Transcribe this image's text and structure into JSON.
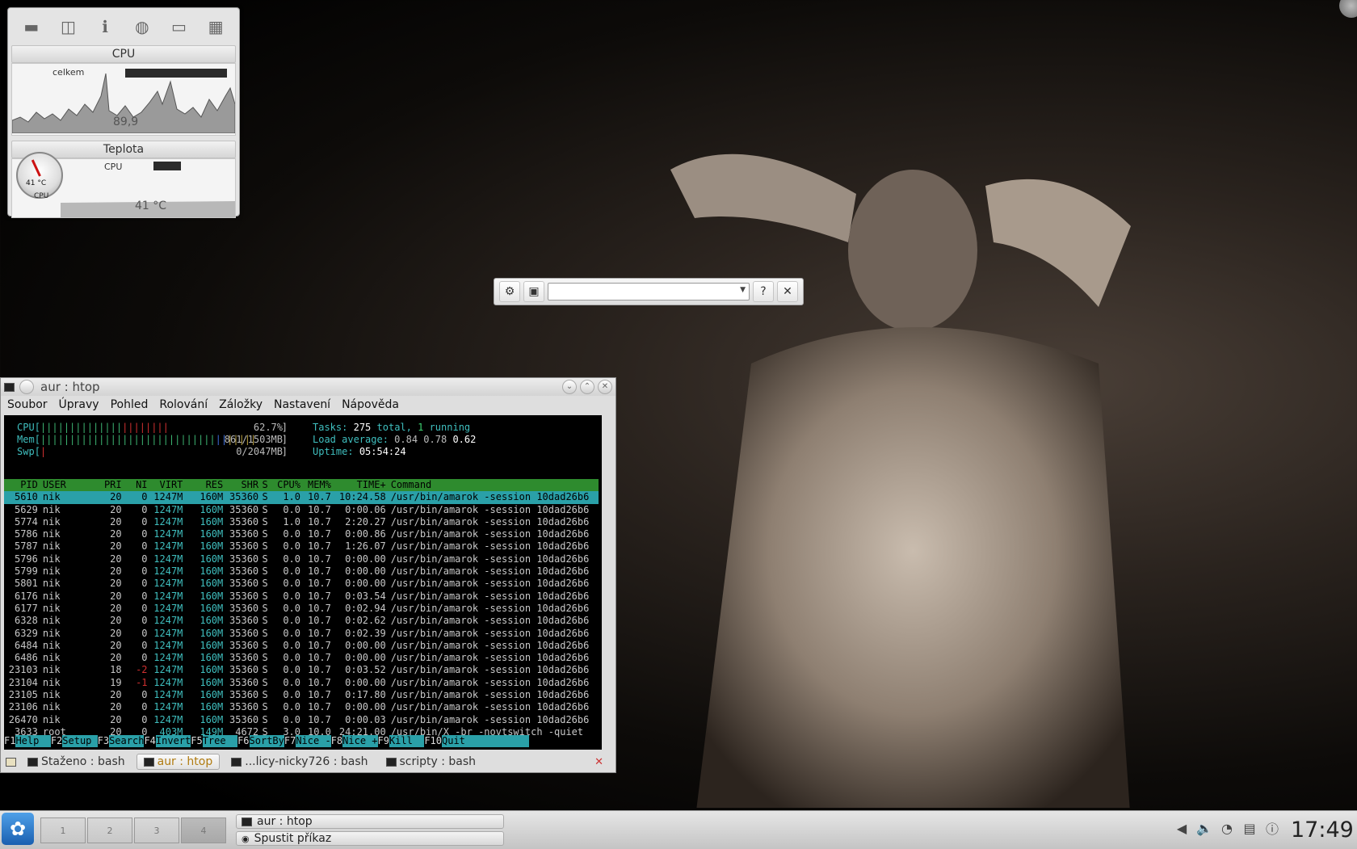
{
  "sysmon": {
    "icons": [
      "hdd-icon",
      "disk-icon",
      "info-icon",
      "network-icon",
      "battery-icon",
      "chip-icon"
    ],
    "cpu": {
      "title": "CPU",
      "label": "celkem",
      "value": "89,9"
    },
    "temp": {
      "title": "Teplota",
      "label": "CPU",
      "value": "41 °C",
      "gauge_value": "41 °C",
      "gauge_caption": "CPU"
    }
  },
  "krunner": {
    "input_value": ""
  },
  "konsole": {
    "title": "aur : htop",
    "menu": [
      "Soubor",
      "Úpravy",
      "Pohled",
      "Rolování",
      "Záložky",
      "Nastavení",
      "Nápověda"
    ],
    "htop": {
      "cpu": {
        "label": "CPU",
        "value": "62.7%"
      },
      "mem": {
        "label": "Mem",
        "value": "861/1503MB"
      },
      "swp": {
        "label": "Swp",
        "value": "0/2047MB"
      },
      "tasks_label": "Tasks:",
      "tasks_total": "275",
      "tasks_total_suffix": "total,",
      "tasks_running": "1",
      "tasks_running_suffix": "running",
      "load_label": "Load average:",
      "load1": "0.84",
      "load5": "0.78",
      "load15": "0.62",
      "uptime_label": "Uptime:",
      "uptime": "05:54:24",
      "header": [
        "PID",
        "USER",
        "PRI",
        "NI",
        "VIRT",
        "RES",
        "SHR",
        "S",
        "CPU%",
        "MEM%",
        "TIME+",
        "Command"
      ],
      "rows": [
        [
          "5610",
          "nik",
          "20",
          "0",
          "1247M",
          "160M",
          "35360",
          "S",
          "1.0",
          "10.7",
          "10:24.58",
          "/usr/bin/amarok -session 10dad26b6"
        ],
        [
          "5629",
          "nik",
          "20",
          "0",
          "1247M",
          "160M",
          "35360",
          "S",
          "0.0",
          "10.7",
          "0:00.06",
          "/usr/bin/amarok -session 10dad26b6"
        ],
        [
          "5774",
          "nik",
          "20",
          "0",
          "1247M",
          "160M",
          "35360",
          "S",
          "1.0",
          "10.7",
          "2:20.27",
          "/usr/bin/amarok -session 10dad26b6"
        ],
        [
          "5786",
          "nik",
          "20",
          "0",
          "1247M",
          "160M",
          "35360",
          "S",
          "0.0",
          "10.7",
          "0:00.86",
          "/usr/bin/amarok -session 10dad26b6"
        ],
        [
          "5787",
          "nik",
          "20",
          "0",
          "1247M",
          "160M",
          "35360",
          "S",
          "0.0",
          "10.7",
          "1:26.07",
          "/usr/bin/amarok -session 10dad26b6"
        ],
        [
          "5796",
          "nik",
          "20",
          "0",
          "1247M",
          "160M",
          "35360",
          "S",
          "0.0",
          "10.7",
          "0:00.00",
          "/usr/bin/amarok -session 10dad26b6"
        ],
        [
          "5799",
          "nik",
          "20",
          "0",
          "1247M",
          "160M",
          "35360",
          "S",
          "0.0",
          "10.7",
          "0:00.00",
          "/usr/bin/amarok -session 10dad26b6"
        ],
        [
          "5801",
          "nik",
          "20",
          "0",
          "1247M",
          "160M",
          "35360",
          "S",
          "0.0",
          "10.7",
          "0:00.00",
          "/usr/bin/amarok -session 10dad26b6"
        ],
        [
          "6176",
          "nik",
          "20",
          "0",
          "1247M",
          "160M",
          "35360",
          "S",
          "0.0",
          "10.7",
          "0:03.54",
          "/usr/bin/amarok -session 10dad26b6"
        ],
        [
          "6177",
          "nik",
          "20",
          "0",
          "1247M",
          "160M",
          "35360",
          "S",
          "0.0",
          "10.7",
          "0:02.94",
          "/usr/bin/amarok -session 10dad26b6"
        ],
        [
          "6328",
          "nik",
          "20",
          "0",
          "1247M",
          "160M",
          "35360",
          "S",
          "0.0",
          "10.7",
          "0:02.62",
          "/usr/bin/amarok -session 10dad26b6"
        ],
        [
          "6329",
          "nik",
          "20",
          "0",
          "1247M",
          "160M",
          "35360",
          "S",
          "0.0",
          "10.7",
          "0:02.39",
          "/usr/bin/amarok -session 10dad26b6"
        ],
        [
          "6484",
          "nik",
          "20",
          "0",
          "1247M",
          "160M",
          "35360",
          "S",
          "0.0",
          "10.7",
          "0:00.00",
          "/usr/bin/amarok -session 10dad26b6"
        ],
        [
          "6486",
          "nik",
          "20",
          "0",
          "1247M",
          "160M",
          "35360",
          "S",
          "0.0",
          "10.7",
          "0:00.00",
          "/usr/bin/amarok -session 10dad26b6"
        ],
        [
          "23103",
          "nik",
          "18",
          "-2",
          "1247M",
          "160M",
          "35360",
          "S",
          "0.0",
          "10.7",
          "0:03.52",
          "/usr/bin/amarok -session 10dad26b6"
        ],
        [
          "23104",
          "nik",
          "19",
          "-1",
          "1247M",
          "160M",
          "35360",
          "S",
          "0.0",
          "10.7",
          "0:00.00",
          "/usr/bin/amarok -session 10dad26b6"
        ],
        [
          "23105",
          "nik",
          "20",
          "0",
          "1247M",
          "160M",
          "35360",
          "S",
          "0.0",
          "10.7",
          "0:17.80",
          "/usr/bin/amarok -session 10dad26b6"
        ],
        [
          "23106",
          "nik",
          "20",
          "0",
          "1247M",
          "160M",
          "35360",
          "S",
          "0.0",
          "10.7",
          "0:00.00",
          "/usr/bin/amarok -session 10dad26b6"
        ],
        [
          "26470",
          "nik",
          "20",
          "0",
          "1247M",
          "160M",
          "35360",
          "S",
          "0.0",
          "10.7",
          "0:00.03",
          "/usr/bin/amarok -session 10dad26b6"
        ],
        [
          "3633",
          "root",
          "20",
          "0",
          "403M",
          "149M",
          "4672",
          "S",
          "3.0",
          "10.0",
          "24:21.00",
          "/usr/bin/X -br -novtswitch -quiet"
        ]
      ],
      "fkeys": [
        [
          "F1",
          "Help  "
        ],
        [
          "F2",
          "Setup "
        ],
        [
          "F3",
          "Search"
        ],
        [
          "F4",
          "Invert"
        ],
        [
          "F5",
          "Tree  "
        ],
        [
          "F6",
          "SortBy"
        ],
        [
          "F7",
          "Nice -"
        ],
        [
          "F8",
          "Nice +"
        ],
        [
          "F9",
          "Kill  "
        ],
        [
          "F10",
          "Quit           "
        ]
      ]
    },
    "tabs": [
      {
        "label": "Staženo : bash",
        "active": false
      },
      {
        "label": "aur : htop",
        "active": true
      },
      {
        "label": "...licy-nicky726 : bash",
        "active": false
      },
      {
        "label": "scripty : bash",
        "active": false
      }
    ]
  },
  "panel": {
    "pager": [
      "1",
      "2",
      "3",
      "4"
    ],
    "tasks": [
      "aur : htop",
      "Spustit příkaz"
    ],
    "tray_icons": [
      "arrow-left-icon",
      "volume-icon",
      "network-manager-icon",
      "klipper-icon",
      "info-icon"
    ],
    "clock": "17:49"
  }
}
